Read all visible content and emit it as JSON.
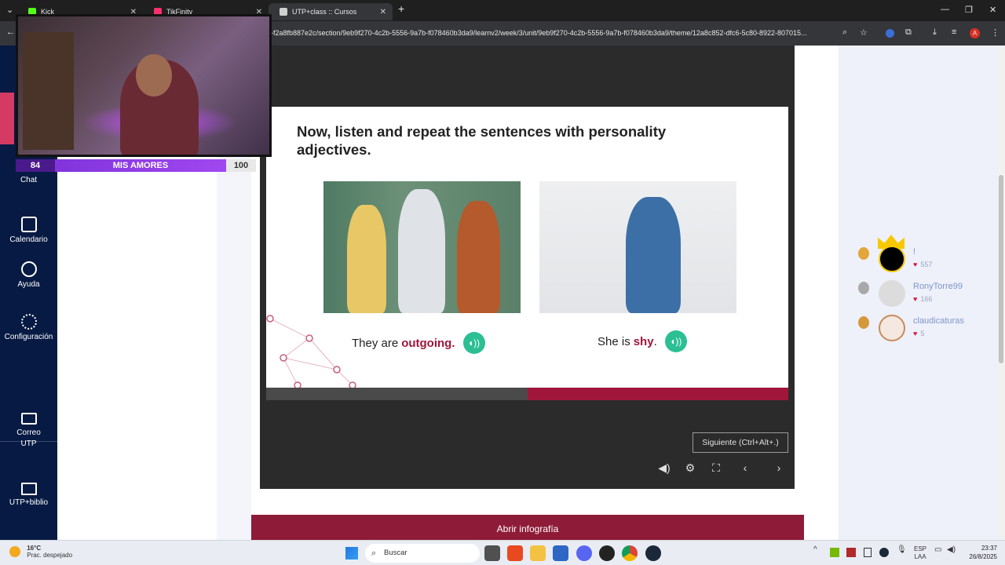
{
  "browser": {
    "tabs": [
      {
        "title": "Kick",
        "favicon": "kick-icon"
      },
      {
        "title": "TikFinity",
        "favicon": "tikfinity-icon"
      },
      {
        "title": "UTP+class :: Cursos",
        "favicon": "page-icon",
        "active": true
      }
    ],
    "new_tab": "+",
    "url": "1-f2a8fb887e2c/section/9eb9f270-4c2b-5556-9a7b-f078460b3da9/learnv2/week/3/unit/9eb9f270-4c2b-5556-9a7b-f078460b3da9/theme/12a8c852-dfc6-5c80-8922-807015...",
    "profile_initial": "A"
  },
  "leftnav": {
    "items": [
      {
        "label": "Chat",
        "icon": "chat-icon"
      },
      {
        "label": "Calendario",
        "icon": "calendar-icon"
      },
      {
        "label": "Ayuda",
        "icon": "help-icon"
      },
      {
        "label": "Configuración",
        "icon": "gear-icon"
      },
      {
        "label": "Correo UTP",
        "icon": "mail-icon"
      },
      {
        "label": "UTP+biblio",
        "icon": "book-icon"
      }
    ]
  },
  "overlay": {
    "bar_left": "84",
    "bar_label": "MIS AMORES",
    "bar_right": "100",
    "bar_progress": 0.84
  },
  "slide": {
    "title": "Now, listen and repeat the sentences with personality adjectives.",
    "captions": [
      {
        "prefix": "They are",
        "adjective": "outgoing."
      },
      {
        "prefix": "She is",
        "adjective": "shy",
        "suffix": "."
      }
    ]
  },
  "player": {
    "progress": 0.5,
    "next_tooltip": "Siguiente (Ctrl+Alt+.)",
    "controls": [
      "volume-icon",
      "settings-icon",
      "fullscreen-icon",
      "prev-icon",
      "next-icon"
    ]
  },
  "infografia_button": "Abrir infografía",
  "leaderboard": [
    {
      "name": "!",
      "hearts": "557",
      "medal": "gold"
    },
    {
      "name": "RonyTorre99",
      "hearts": "166",
      "medal": "silver"
    },
    {
      "name": "claudicaturas",
      "hearts": "5",
      "medal": "bronze"
    }
  ],
  "taskbar": {
    "temperature": "16°C",
    "weather": "Prac. despejado",
    "search_placeholder": "Buscar",
    "lang_top": "ESP",
    "lang_bottom": "LAA",
    "time": "23:37",
    "date": "26/8/2025"
  },
  "colors": {
    "accent": "#a0163b",
    "nav_bg": "#071a43",
    "sound_button": "#2bbf93"
  }
}
